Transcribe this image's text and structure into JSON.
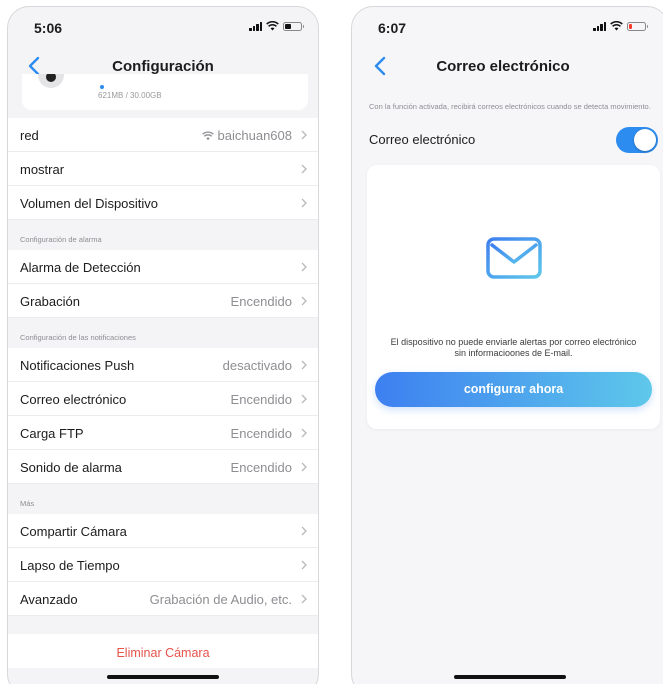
{
  "left_screen": {
    "status": {
      "time": "5:06"
    },
    "nav": {
      "title": "Configuración"
    },
    "storage": {
      "text": "621MB / 30.00GB"
    },
    "rows_top": [
      {
        "label": "red",
        "value": "baichuan608",
        "icon": "wifi-icon"
      },
      {
        "label": "mostrar",
        "value": ""
      },
      {
        "label": "Volumen del Dispositivo",
        "value": ""
      }
    ],
    "section_alarm": {
      "header": "Configuración de alarma",
      "rows": [
        {
          "label": "Alarma de Detección",
          "value": ""
        },
        {
          "label": "Grabación",
          "value": "Encendido"
        }
      ]
    },
    "section_notifications": {
      "header": "Configuración de las notificaciones",
      "rows": [
        {
          "label": "Notificaciones Push",
          "value": "desactivado"
        },
        {
          "label": "Correo electrónico",
          "value": "Encendido"
        },
        {
          "label": "Carga FTP",
          "value": "Encendido"
        },
        {
          "label": "Sonido de alarma",
          "value": "Encendido"
        }
      ]
    },
    "section_more": {
      "header": "Más",
      "rows": [
        {
          "label": "Compartir Cámara",
          "value": ""
        },
        {
          "label": "Lapso de Tiempo",
          "value": ""
        },
        {
          "label": "Avanzado",
          "value": "Grabación de Audio, etc."
        }
      ]
    },
    "delete_label": "Eliminar Cámara"
  },
  "right_screen": {
    "status": {
      "time": "6:07"
    },
    "nav": {
      "title": "Correo electrónico"
    },
    "info": "Con la función activada, recibirá correos electrónicos cuando se detecta movimiento.",
    "toggle": {
      "label": "Correo electrónico",
      "enabled": true
    },
    "card": {
      "icon": "envelope-icon",
      "message": "El dispositivo no puede enviarle alertas por correo electrónico sin informacioones de E-mail.",
      "button_label": "configurar ahora"
    }
  },
  "colors": {
    "accent": "#2d8cf0",
    "toggle_on": "#2d8cf0",
    "danger": "#e5534b",
    "button_gradient_start": "#3d7ff0",
    "button_gradient_end": "#5ec8ea",
    "battery_left": "#111111",
    "battery_right": "#ff3b30"
  }
}
